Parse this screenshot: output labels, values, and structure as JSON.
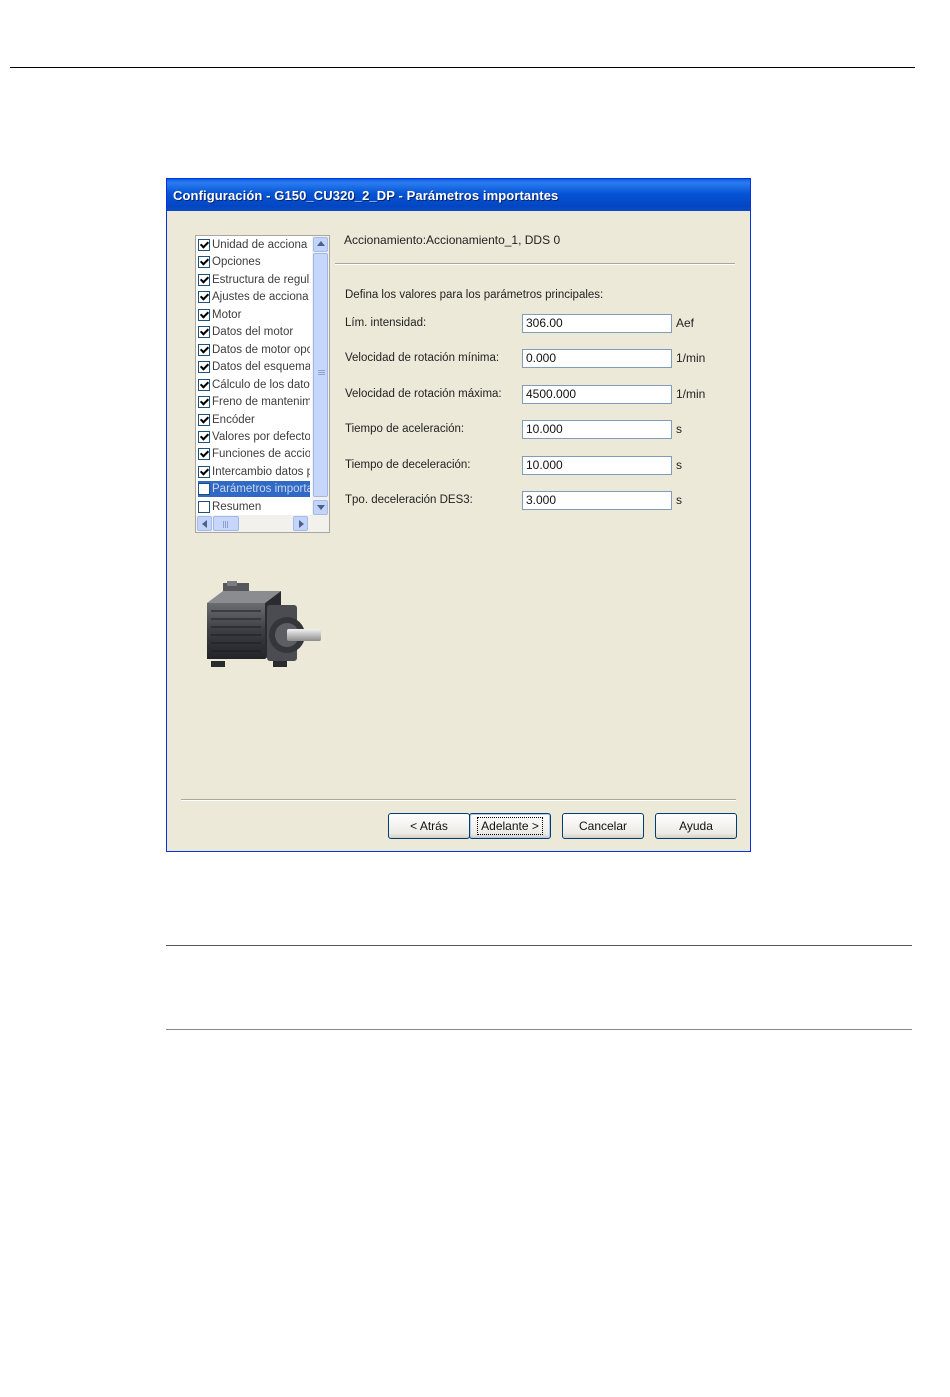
{
  "window": {
    "title": "Configuración - G150_CU320_2_DP - Parámetros importantes"
  },
  "tree": {
    "items": [
      {
        "label": "Unidad de acciona",
        "checked": true,
        "selected": false
      },
      {
        "label": "Opciones",
        "checked": true,
        "selected": false
      },
      {
        "label": "Estructura de regul",
        "checked": true,
        "selected": false
      },
      {
        "label": "Ajustes de acciona",
        "checked": true,
        "selected": false
      },
      {
        "label": "Motor",
        "checked": true,
        "selected": false
      },
      {
        "label": "Datos del motor",
        "checked": true,
        "selected": false
      },
      {
        "label": "Datos de motor opc",
        "checked": true,
        "selected": false
      },
      {
        "label": "Datos del esquema",
        "checked": true,
        "selected": false
      },
      {
        "label": "Cálculo de los dato",
        "checked": true,
        "selected": false
      },
      {
        "label": "Freno de mantenim",
        "checked": true,
        "selected": false
      },
      {
        "label": "Encóder",
        "checked": true,
        "selected": false
      },
      {
        "label": "Valores por defecto",
        "checked": true,
        "selected": false
      },
      {
        "label": "Funciones de accio",
        "checked": true,
        "selected": false
      },
      {
        "label": "Intercambio datos p",
        "checked": true,
        "selected": false
      },
      {
        "label": "Parámetros importa",
        "checked": false,
        "selected": true
      },
      {
        "label": "Resumen",
        "checked": false,
        "selected": false
      }
    ]
  },
  "panel": {
    "header": "Accionamiento:Accionamiento_1, DDS 0",
    "prompt": "Defina los valores para los parámetros principales:",
    "params": [
      {
        "label": "Lím. intensidad:",
        "value": "306.00",
        "unit": "Aef"
      },
      {
        "label": "Velocidad de rotación mínima:",
        "value": "0.000",
        "unit": "1/min"
      },
      {
        "label": "Velocidad de rotación máxima:",
        "value": "4500.000",
        "unit": "1/min"
      },
      {
        "label": "Tiempo de aceleración:",
        "value": "10.000",
        "unit": "s"
      },
      {
        "label": "Tiempo de deceleración:",
        "value": "10.000",
        "unit": "s"
      },
      {
        "label": "Tpo. deceleración DES3:",
        "value": "3.000",
        "unit": "s"
      }
    ]
  },
  "buttons": {
    "back": "< Atrás",
    "next": "Adelante >",
    "cancel": "Cancelar",
    "help": "Ayuda"
  },
  "colors": {
    "titlebar": "#0655d6",
    "dialog_bg": "#ece9d8",
    "selection": "#316ac5"
  }
}
